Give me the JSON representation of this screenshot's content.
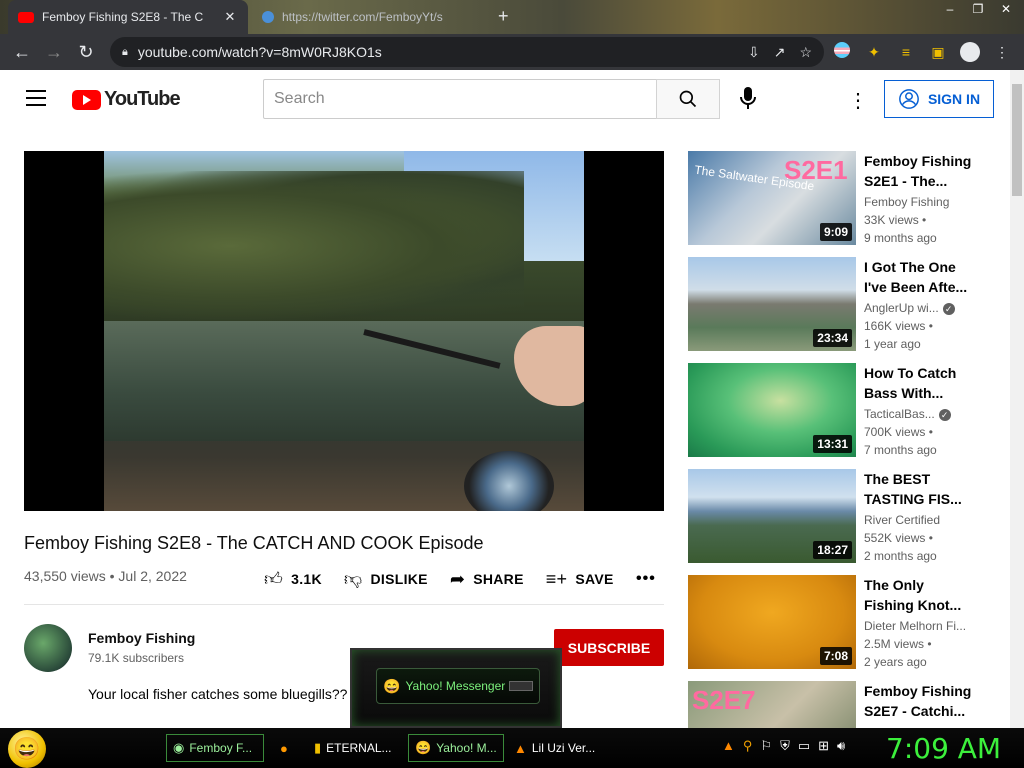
{
  "browser": {
    "tabs": [
      {
        "title": "Femboy Fishing S2E8 - The C",
        "active": true
      },
      {
        "title": "https://twitter.com/FemboyYt/s",
        "active": false
      }
    ],
    "new_tab": "+",
    "window_controls": [
      "–",
      "❐",
      "✕"
    ],
    "url": "youtube.com/watch?v=8mW0RJ8KO1s"
  },
  "youtube": {
    "logo_text": "YouTube",
    "search_placeholder": "Search",
    "sign_in_label": "SIGN IN",
    "accent_color": "#ff0000",
    "link_color": "#065fd4"
  },
  "video": {
    "title": "Femboy Fishing S2E8 - The CATCH AND COOK Episode",
    "views": "43,550 views",
    "date": "Jul 2, 2022",
    "likes": "3.1K",
    "dislike_label": "DISLIKE",
    "share_label": "SHARE",
    "save_label": "SAVE",
    "more": "•••",
    "channel": "Femboy Fishing",
    "subscribers": "79.1K subscribers",
    "subscribe_label": "SUBSCRIBE",
    "description": "Your local fisher catches some bluegills??"
  },
  "recommendations": [
    {
      "title": "Femboy Fishing S2E1 - The...",
      "channel": "Femboy Fishing",
      "views": "33K views •",
      "age": "9 months ago",
      "duration": "9:09",
      "verified": false
    },
    {
      "title": "I Got The One I've Been Afte...",
      "channel": "AnglerUp wi...",
      "views": "166K views •",
      "age": "1 year ago",
      "duration": "23:34",
      "verified": true
    },
    {
      "title": "How To Catch Bass With...",
      "channel": "TacticalBas...",
      "views": "700K views •",
      "age": "7 months ago",
      "duration": "13:31",
      "verified": true
    },
    {
      "title": "The BEST TASTING FIS...",
      "channel": "River Certified",
      "views": "552K views •",
      "age": "2 months ago",
      "duration": "18:27",
      "verified": false
    },
    {
      "title": "The Only Fishing Knot...",
      "channel": "Dieter Melhorn Fi...",
      "views": "2.5M views •",
      "age": "2 years ago",
      "duration": "7:08",
      "verified": false
    },
    {
      "title": "Femboy Fishing S2E7 - Catchi...",
      "channel": "",
      "views": "",
      "age": "",
      "duration": "",
      "verified": false
    }
  ],
  "thumb_texts": {
    "s2e1": "S2E1",
    "s2e1_sub": "The Saltwater Episode",
    "s2e7": "S2E7"
  },
  "popup": {
    "label": "Yahoo! Messenger"
  },
  "taskbar": {
    "items": [
      {
        "label": "Femboy F...",
        "icon": "chrome-icon",
        "active": true
      },
      {
        "label": "",
        "icon": "firefox-icon",
        "active": false
      },
      {
        "label": "ETERNAL...",
        "icon": "document-icon",
        "active": false
      },
      {
        "label": "Yahoo! M...",
        "icon": "yahoo-smiley-icon",
        "active": true
      },
      {
        "label": "Lil Uzi Ver...",
        "icon": "vlc-icon",
        "active": false
      }
    ],
    "clock": "7:09 AM"
  }
}
